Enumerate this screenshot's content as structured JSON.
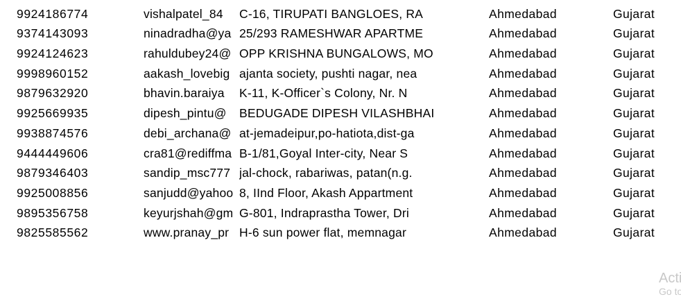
{
  "sheet": {
    "rows": [
      {
        "phone": "9924186774",
        "email": "vishalpatel_84",
        "address": "C-16, TIRUPATI BANGLOES, RA",
        "city": "Ahmedabad",
        "state": "Gujarat"
      },
      {
        "phone": "9374143093",
        "email": "ninadradha@ya",
        "address": "25/293 RAMESHWAR APARTME",
        "city": "Ahmedabad",
        "state": "Gujarat"
      },
      {
        "phone": "9924124623",
        "email": "rahuldubey24@",
        "address": "OPP KRISHNA BUNGALOWS, MO",
        "city": "Ahmedabad",
        "state": "Gujarat"
      },
      {
        "phone": "9998960152",
        "email": "aakash_lovebig",
        "address": "ajanta society, pushti nagar, nea",
        "city": "Ahmedabad",
        "state": "Gujarat"
      },
      {
        "phone": "9879632920",
        "email": "bhavin.baraiya",
        "address": "K-11, K-Officer`s Colony, Nr. N",
        "city": "Ahmedabad",
        "state": "Gujarat"
      },
      {
        "phone": "9925669935",
        "email": "dipesh_pintu@",
        "address": "BEDUGADE DIPESH VILASHBHAI .",
        "city": "Ahmedabad",
        "state": "Gujarat"
      },
      {
        "phone": "9938874576",
        "email": "debi_archana@",
        "address": "at-jemadeipur,po-hatiota,dist-ga",
        "city": "Ahmedabad",
        "state": "Gujarat"
      },
      {
        "phone": "9444449606",
        "email": "cra81@rediffma",
        "address": "B-1/81,Goyal Inter-city, Near S",
        "city": "Ahmedabad",
        "state": "Gujarat"
      },
      {
        "phone": "9879346403",
        "email": "sandip_msc777",
        "address": "jal-chock, rabariwas, patan(n.g.",
        "city": "Ahmedabad",
        "state": "Gujarat"
      },
      {
        "phone": "9925008856",
        "email": "sanjudd@yahoo",
        "address": "8, IInd Floor, Akash Appartment",
        "city": "Ahmedabad",
        "state": "Gujarat"
      },
      {
        "phone": "9895356758",
        "email": "keyurjshah@gm",
        "address": "G-801, Indraprastha Tower, Dri",
        "city": "Ahmedabad",
        "state": "Gujarat"
      },
      {
        "phone": "9825585562",
        "email": "www.pranay_pr",
        "address": "H-6 sun power flat, memnagar",
        "city": "Ahmedabad",
        "state": "Gujarat"
      }
    ]
  },
  "watermark": {
    "line1": "Acti",
    "line2": "Go to"
  }
}
